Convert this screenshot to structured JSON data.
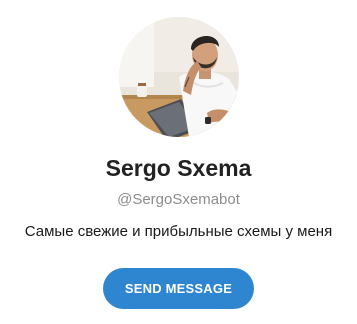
{
  "profile": {
    "display_name": "Sergo Sxema",
    "username": "@SergoSxemabot",
    "description": "Самые свежие и прибыльные схемы у меня"
  },
  "actions": {
    "send_message_label": "SEND MESSAGE"
  },
  "colors": {
    "button_background": "#2f86d0",
    "button_text": "#ffffff",
    "name_text": "#222222",
    "username_text": "#8c8c8c",
    "description_text": "#1a1a1a"
  },
  "icons": {
    "avatar": "profile-photo"
  }
}
